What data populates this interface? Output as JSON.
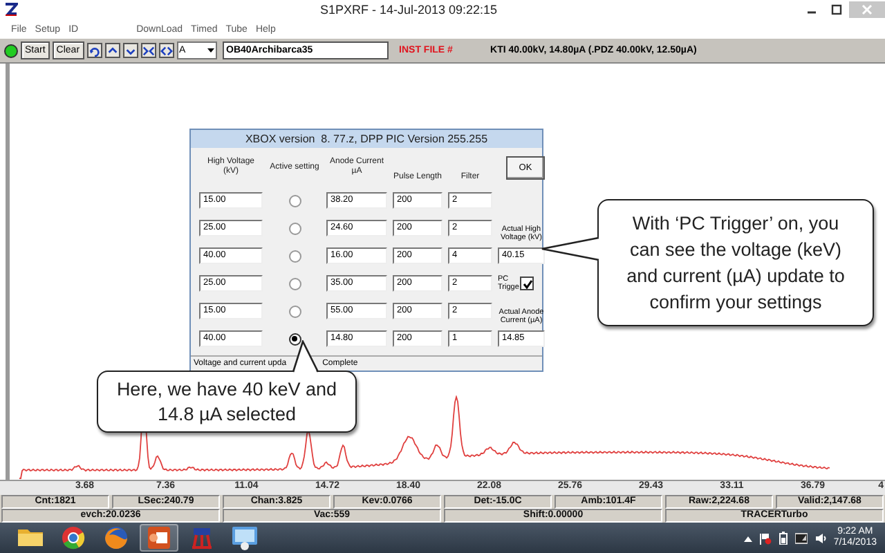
{
  "window": {
    "title": "S1PXRF - 14-Jul-2013 09:22:15"
  },
  "menu": [
    "File",
    "Setup",
    "ID",
    "DownLoad",
    "Timed",
    "Tube",
    "Help"
  ],
  "toolbar": {
    "status_light": {
      "on": true
    },
    "buttons": [
      "Start",
      "Clear"
    ],
    "channel_select": {
      "value": "A"
    },
    "file_field": {
      "value": "OB40Archibarca35"
    },
    "inst_file_label": "INST FILE #",
    "tube_info": "KTI 40.00kV, 14.80µA (.PDZ 40.00kV, 12.50µA)"
  },
  "spectrum": {
    "x_labels": [
      "3.68",
      "7.36",
      "11.04",
      "14.72",
      "18.40",
      "22.08",
      "25.76",
      "29.43",
      "33.11",
      "36.79",
      "4"
    ]
  },
  "status_bar": {
    "row_1": [
      "Cnt:1821",
      "LSec:240.79",
      "Chan:3.825",
      "Kev:0.0766",
      "Det:-15.0C",
      "Amb:101.4F",
      "Raw:2,224.68",
      "Valid:2,147.68"
    ],
    "row_2": [
      "evch:20.0236",
      "Vac:559",
      "Shift:0.00000",
      "TRACERTurbo"
    ]
  },
  "dialog": {
    "title": "XBOX version  8. 77.z, DPP PIC Version 255.255",
    "columns": [
      "High Voltage (kV)",
      "Active setting",
      "Anode Current µA",
      "Pulse Length",
      "Filter"
    ],
    "settings": [
      {
        "voltage": "15.00",
        "selected": false,
        "current": "38.20",
        "pulse": "200",
        "filter": "2"
      },
      {
        "voltage": "25.00",
        "selected": false,
        "current": "24.60",
        "pulse": "200",
        "filter": "2"
      },
      {
        "voltage": "40.00",
        "selected": false,
        "current": "16.00",
        "pulse": "200",
        "filter": "4"
      },
      {
        "voltage": "25.00",
        "selected": false,
        "current": "35.00",
        "pulse": "200",
        "filter": "2"
      },
      {
        "voltage": "15.00",
        "selected": false,
        "current": "55.00",
        "pulse": "200",
        "filter": "2"
      },
      {
        "voltage": "40.00",
        "selected": true,
        "current": "14.80",
        "pulse": "200",
        "filter": "1"
      }
    ],
    "ok_button": "OK",
    "actual_voltage_label": "Actual High Voltage (kV)",
    "actual_voltage": "40.15",
    "pc_trigger": {
      "label": "PC Trigge",
      "checked": true
    },
    "actual_current_label": "Actual Anode Current (µA)",
    "actual_current": "14.85",
    "status": [
      "Voltage and current upda",
      "Complete"
    ]
  },
  "callouts": [
    {
      "text": "Here, we have 40 keV and 14.8 µA selected"
    },
    {
      "text": "With ‘PC Trigger’ on, you can see the voltage (keV) and current (µA) update to confirm your settings"
    }
  ],
  "taskbar": {
    "time": "9:22 AM",
    "date": "7/14/2013"
  }
}
